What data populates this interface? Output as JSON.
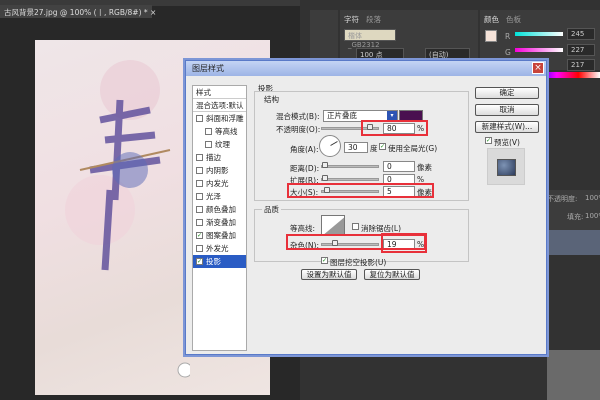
{
  "document": {
    "tab_title": "古风背景27.jpg @ 100% (丨, RGB/8#) *",
    "close": "×"
  },
  "character_panel": {
    "tabs": [
      "字符",
      "段落"
    ],
    "font": "楷体_GB2312",
    "size": "100 点",
    "leading": "(自动)"
  },
  "color_panel": {
    "tabs": [
      "颜色",
      "色板"
    ],
    "r_label": "R",
    "g_label": "G",
    "r": "245",
    "g": "227",
    "b": "217",
    "foreground": "#f5e3d9"
  },
  "layers_panel": {
    "opacity_label": "不透明度:",
    "opacity": "100%",
    "fill_label": "填充:",
    "fill": "100%"
  },
  "dialog": {
    "title": "图层样式",
    "close": "×",
    "styles_header": "样式",
    "blend_options": "混合选项:默认",
    "styles": [
      {
        "label": "斜面和浮雕",
        "checked": false,
        "indent": false
      },
      {
        "label": "等高线",
        "checked": false,
        "indent": true
      },
      {
        "label": "纹理",
        "checked": false,
        "indent": true
      },
      {
        "label": "描边",
        "checked": false,
        "indent": false
      },
      {
        "label": "内阴影",
        "checked": false,
        "indent": false
      },
      {
        "label": "内发光",
        "checked": false,
        "indent": false
      },
      {
        "label": "光泽",
        "checked": false,
        "indent": false
      },
      {
        "label": "颜色叠加",
        "checked": false,
        "indent": false
      },
      {
        "label": "渐变叠加",
        "checked": false,
        "indent": false
      },
      {
        "label": "图案叠加",
        "checked": true,
        "indent": false
      },
      {
        "label": "外发光",
        "checked": false,
        "indent": false
      },
      {
        "label": "投影",
        "checked": true,
        "indent": false,
        "selected": true
      }
    ],
    "section_title": "投影",
    "structure": {
      "title": "结构",
      "blend_mode_label": "混合模式(B):",
      "blend_mode": "正片叠底",
      "shadow_color": "#4a1050",
      "opacity_label": "不透明度(O):",
      "opacity": "80",
      "opacity_unit": "%",
      "angle_label": "角度(A):",
      "angle": "30",
      "angle_unit": "度",
      "global_light": "使用全局光(G)",
      "global_light_checked": true,
      "distance_label": "距离(D):",
      "distance": "0",
      "distance_unit": "像素",
      "spread_label": "扩展(R):",
      "spread": "0",
      "spread_unit": "%",
      "size_label": "大小(S):",
      "size": "5",
      "size_unit": "像素"
    },
    "quality": {
      "title": "品质",
      "contour_label": "等高线:",
      "antialias": "消除锯齿(L)",
      "antialias_checked": false,
      "noise_label": "杂色(N):",
      "noise": "19",
      "noise_unit": "%"
    },
    "knockout": "图层挖空投影(U)",
    "knockout_checked": true,
    "make_default": "设置为默认值",
    "reset_default": "复位为默认值",
    "ok": "确定",
    "cancel": "取消",
    "new_style": "新建样式(W)...",
    "preview": "预览(V)",
    "preview_checked": true
  }
}
